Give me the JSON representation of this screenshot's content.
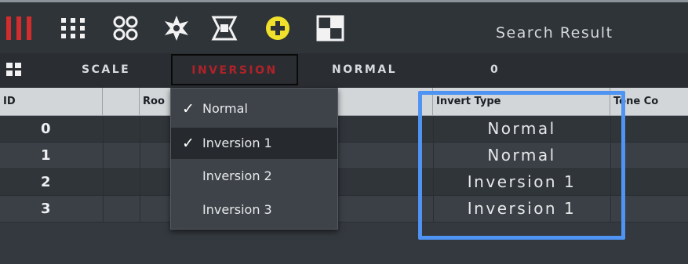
{
  "toolbar": {
    "title": "Search Result",
    "icons": [
      "bars-icon",
      "grid-icon",
      "rings-icon",
      "star-icon",
      "frame-icon",
      "add-icon",
      "checker-icon"
    ],
    "accent_red": "#d22c2c",
    "accent_yellow": "#f0e12a"
  },
  "subbar": {
    "scale_label": "SCALE",
    "inversion_label": "INVERSION",
    "normal_label": "NORMAL",
    "zero_label": "0"
  },
  "table": {
    "columns": [
      "ID",
      "",
      "Roo",
      "",
      "Invert Type",
      "Tone Co"
    ],
    "rows": [
      {
        "id": "0",
        "invert_type": "Normal"
      },
      {
        "id": "1",
        "invert_type": "Normal"
      },
      {
        "id": "2",
        "invert_type": "Inversion 1"
      },
      {
        "id": "3",
        "invert_type": "Inversion 1"
      }
    ]
  },
  "dropdown": {
    "items": [
      {
        "label": "Normal",
        "check": "✓"
      },
      {
        "label": "Inversion 1",
        "check": "✓"
      },
      {
        "label": "Inversion 2",
        "check": ""
      },
      {
        "label": "Inversion 3",
        "check": ""
      }
    ],
    "selected_label": "Inversion 1"
  },
  "highlight_color": "#4f94f2"
}
